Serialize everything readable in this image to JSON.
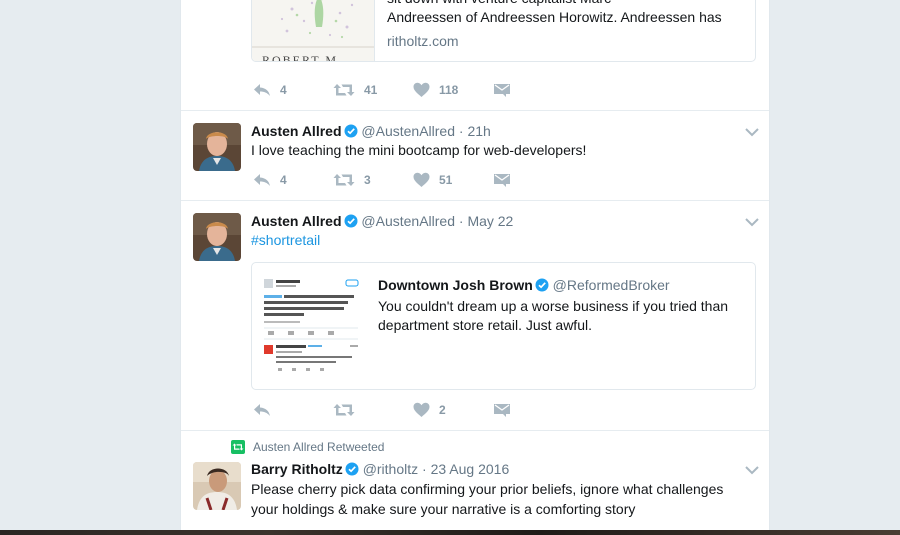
{
  "tweet1": {
    "card": {
      "cover_text": "ROBERT M",
      "line1": "sit down with venture capitalist Marc",
      "line2": "Andreessen of Andreessen Horowitz. Andreessen has",
      "url": "ritholtz.com"
    },
    "actions": {
      "replies": "4",
      "retweets": "41",
      "likes": "118"
    }
  },
  "tweet2": {
    "name": "Austen Allred",
    "handle": "@AustenAllred",
    "time": "21h",
    "text": "I love teaching the mini bootcamp for web-developers!",
    "actions": {
      "replies": "4",
      "retweets": "3",
      "likes": "51"
    }
  },
  "tweet3": {
    "name": "Austen Allred",
    "handle": "@AustenAllred",
    "time": "May 22",
    "text": "#shortretail",
    "quote": {
      "name": "Downtown Josh Brown",
      "handle": "@ReformedBroker",
      "line1": "You couldn't dream up a worse business if you tried than",
      "line2": "department store retail. Just awful."
    },
    "actions": {
      "replies": "",
      "retweets": "",
      "likes": "2"
    }
  },
  "tweet4": {
    "retweet_context": "Austen Allred Retweeted",
    "name": "Barry Ritholtz",
    "handle": "@ritholtz",
    "time": "23 Aug 2016",
    "line1": "Please cherry pick data confirming your prior beliefs, ignore what challenges",
    "line2": "your holdings & make sure your narrative is a comforting story"
  },
  "separator": "·",
  "colors": {
    "accent": "#1da1f2",
    "link": "#1b95e0",
    "retweet_green": "#17bf63",
    "muted": "#657786"
  }
}
